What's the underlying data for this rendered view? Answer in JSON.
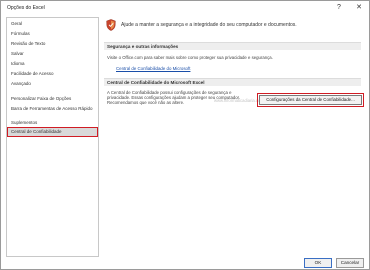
{
  "window": {
    "title": "Opções do Excel",
    "help_glyph": "?",
    "close_glyph": "✕"
  },
  "sidebar": {
    "items": [
      {
        "label": "Geral"
      },
      {
        "label": "Fórmulas"
      },
      {
        "label": "Revisão de Texto"
      },
      {
        "label": "Salvar"
      },
      {
        "label": "Idioma"
      },
      {
        "label": "Facilidade de Acesso"
      },
      {
        "label": "Avançado"
      },
      {
        "label": "Personalizar Faixa de Opções"
      },
      {
        "label": "Barra de Ferramentas de Acesso Rápido"
      },
      {
        "label": "Suplementos"
      },
      {
        "label": "Central de Confiabilidade",
        "selected": true
      }
    ]
  },
  "main": {
    "banner_icon": "shield-icon",
    "banner_text": "Ajude a manter a segurança e a integridade do seu computador e documentos.",
    "security_section": {
      "heading": "Segurança e outras informações",
      "text": "Visite o Office.com para saber mais sobre como proteger sua privacidade e segurança.",
      "link": "Central de Confiabilidade do Microsoft"
    },
    "trust_section": {
      "heading": "Central de Confiabilidade do Microsoft Excel",
      "watermark": "www.informaticadiaria.com.br",
      "text_lines": [
        "A Central de Confiabilidade possui configurações de segurança e",
        "privacidade. Essas configurações ajudam a proteger seu computador.",
        "Recomendamos que você não as altere."
      ],
      "button": "Configurações da Central de Confiabilidade..."
    }
  },
  "footer": {
    "ok": "OK",
    "cancel": "Cancelar"
  },
  "colors": {
    "highlight": "#d01c24",
    "link": "#1a4ea8",
    "shield_red": "#c8442c"
  }
}
